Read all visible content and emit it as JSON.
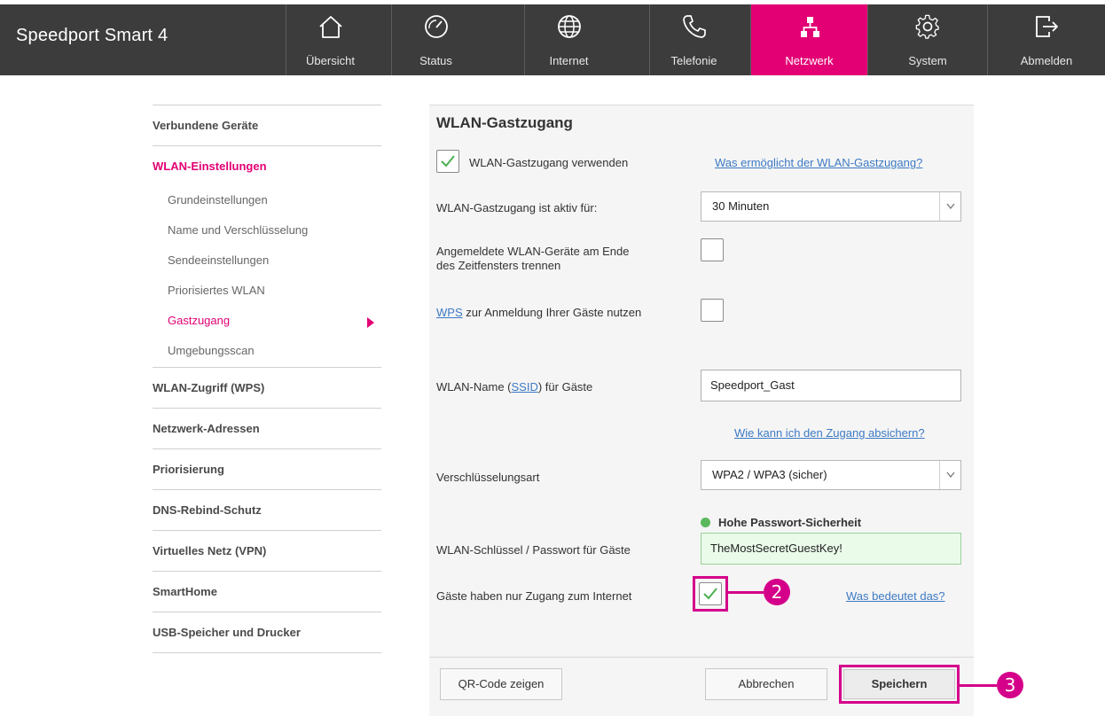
{
  "app": {
    "title": "Speedport Smart 4"
  },
  "nav": {
    "tabs": [
      {
        "label": "Übersicht",
        "icon": "home-icon"
      },
      {
        "label": "Status",
        "icon": "gauge-icon"
      },
      {
        "label": "Internet",
        "icon": "globe-icon"
      },
      {
        "label": "Telefonie",
        "icon": "phone-icon"
      },
      {
        "label": "Netzwerk",
        "icon": "network-icon",
        "active": true
      },
      {
        "label": "System",
        "icon": "gear-icon"
      },
      {
        "label": "Abmelden",
        "icon": "logout-icon"
      }
    ],
    "accent_color": "#e20074"
  },
  "sidebar": {
    "items": [
      {
        "label": "Verbundene Geräte"
      },
      {
        "label": "WLAN-Einstellungen",
        "active": true
      },
      {
        "label": "WLAN-Zugriff (WPS)"
      },
      {
        "label": "Netzwerk-Adressen"
      },
      {
        "label": "Priorisierung"
      },
      {
        "label": "DNS-Rebind-Schutz"
      },
      {
        "label": "Virtuelles Netz (VPN)"
      },
      {
        "label": "SmartHome"
      },
      {
        "label": "USB-Speicher und Drucker"
      }
    ],
    "subitems": [
      {
        "label": "Grundeinstellungen"
      },
      {
        "label": "Name und Verschlüsselung"
      },
      {
        "label": "Sendeeinstellungen"
      },
      {
        "label": "Priorisiertes WLAN"
      },
      {
        "label": "Gastzugang",
        "active": true
      },
      {
        "label": "Umgebungsscan"
      }
    ]
  },
  "form": {
    "title": "WLAN-Gastzugang",
    "enable": {
      "label": "WLAN-Gastzugang verwenden",
      "checked": true,
      "help": "Was ermöglicht der WLAN-Gastzugang?"
    },
    "duration": {
      "label": "WLAN-Gastzugang ist aktiv für:",
      "value": "30 Minuten"
    },
    "disconnect": {
      "label_line1": "Angemeldete WLAN-Geräte am Ende",
      "label_line2": "des Zeitfensters trennen",
      "checked": false
    },
    "wps": {
      "link": "WPS",
      "label_rest": " zur Anmeldung Ihrer Gäste nutzen",
      "checked": false
    },
    "ssid": {
      "label_pre": "WLAN-Name (",
      "link": "SSID",
      "label_post": ") für Gäste",
      "value": "Speedport_Gast"
    },
    "secure_help": "Wie kann ich den Zugang absichern?",
    "encryption": {
      "label": "Verschlüsselungsart",
      "value": "WPA2 / WPA3 (sicher)"
    },
    "strength": {
      "text": "Hohe Passwort-Sicherheit",
      "color": "#5cb85c"
    },
    "password": {
      "label": "WLAN-Schlüssel / Passwort für Gäste",
      "value": "TheMostSecretGuestKey!"
    },
    "internet_only": {
      "label": "Gäste haben nur Zugang zum Internet",
      "checked": true,
      "help": "Was bedeutet das?"
    }
  },
  "buttons": {
    "qr": "QR-Code zeigen",
    "cancel": "Abbrechen",
    "save": "Speichern"
  },
  "annotations": {
    "step2": "2",
    "step3": "3",
    "color": "#d4008a"
  }
}
